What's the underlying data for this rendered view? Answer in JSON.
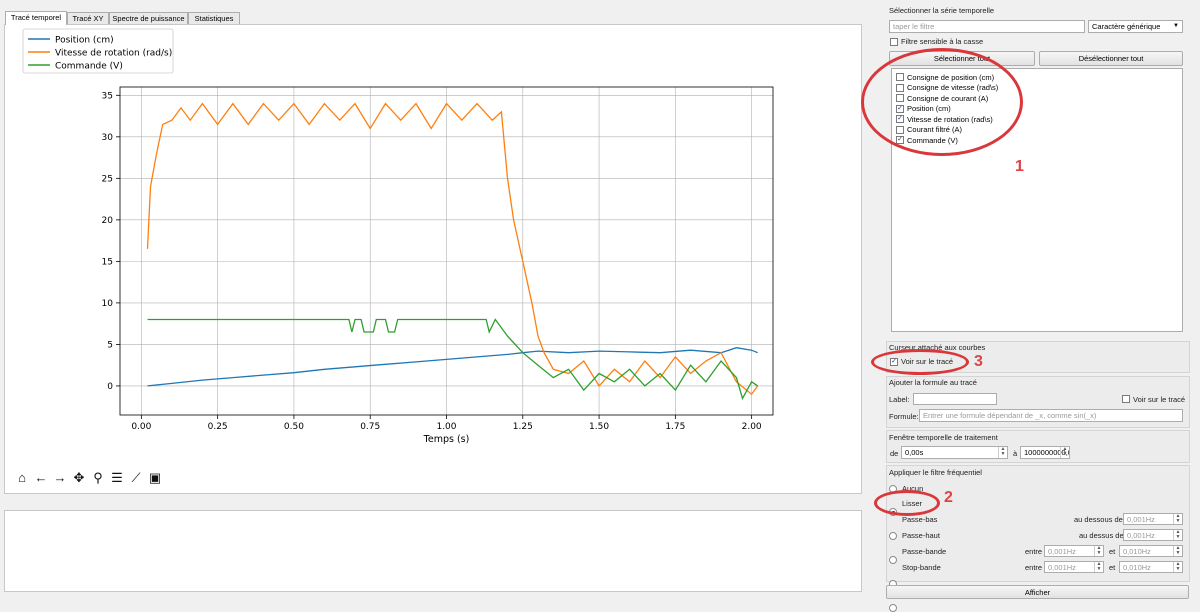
{
  "tabs": [
    "Tracé temporel",
    "Tracé XY",
    "Spectre de puissance",
    "Statistiques"
  ],
  "chart_data": {
    "type": "line",
    "xlabel": "Temps (s)",
    "ylabel": "",
    "xlim": [
      -0.07,
      2.07
    ],
    "ylim": [
      -3.5,
      36
    ],
    "xticks": [
      "0.00",
      "0.25",
      "0.50",
      "0.75",
      "1.00",
      "1.25",
      "1.50",
      "1.75",
      "2.00"
    ],
    "yticks": [
      "0",
      "5",
      "10",
      "15",
      "20",
      "25",
      "30",
      "35"
    ],
    "grid": true,
    "legend_position": "top-left",
    "series": [
      {
        "name": "Position (cm)",
        "color": "#1f77b4",
        "x": [
          0.02,
          0.1,
          0.2,
          0.3,
          0.4,
          0.5,
          0.6,
          0.7,
          0.8,
          0.9,
          1.0,
          1.1,
          1.2,
          1.25,
          1.3,
          1.4,
          1.5,
          1.6,
          1.7,
          1.8,
          1.9,
          1.95,
          2.0,
          2.02
        ],
        "y": [
          0,
          0.3,
          0.7,
          1.0,
          1.3,
          1.6,
          2.0,
          2.3,
          2.6,
          2.9,
          3.2,
          3.5,
          3.8,
          4.0,
          4.2,
          4.0,
          4.2,
          4.1,
          4.0,
          4.3,
          4.0,
          4.6,
          4.3,
          4.0
        ]
      },
      {
        "name": "Vitesse de rotation (rad/s)",
        "color": "#ff7f0e",
        "x": [
          0.02,
          0.03,
          0.05,
          0.07,
          0.1,
          0.13,
          0.16,
          0.2,
          0.25,
          0.3,
          0.35,
          0.4,
          0.45,
          0.5,
          0.55,
          0.6,
          0.65,
          0.7,
          0.75,
          0.8,
          0.85,
          0.9,
          0.95,
          1.0,
          1.05,
          1.1,
          1.15,
          1.18,
          1.2,
          1.22,
          1.25,
          1.28,
          1.3,
          1.32,
          1.35,
          1.4,
          1.45,
          1.5,
          1.55,
          1.6,
          1.65,
          1.7,
          1.75,
          1.8,
          1.85,
          1.9,
          1.95,
          2.0,
          2.02
        ],
        "y": [
          16.5,
          24,
          28,
          31.5,
          32,
          33.5,
          32,
          34,
          31.5,
          34,
          31.5,
          34,
          32,
          34,
          31.5,
          34,
          32,
          34,
          31,
          34,
          32,
          34,
          31,
          34,
          32,
          34,
          32,
          33,
          25,
          20,
          15,
          10,
          6,
          4,
          2,
          1.5,
          3,
          0,
          2,
          0.5,
          3,
          1,
          3.5,
          1.5,
          3,
          4,
          0.5,
          -1,
          0
        ]
      },
      {
        "name": "Commande (V)",
        "color": "#2ca02c",
        "x": [
          0.02,
          0.3,
          0.68,
          0.69,
          0.7,
          0.72,
          0.73,
          0.76,
          0.77,
          0.8,
          0.81,
          0.83,
          0.84,
          1.1,
          1.13,
          1.14,
          1.16,
          1.2,
          1.25,
          1.3,
          1.35,
          1.4,
          1.45,
          1.5,
          1.55,
          1.6,
          1.65,
          1.7,
          1.75,
          1.8,
          1.85,
          1.9,
          1.95,
          1.97,
          2.0,
          2.02
        ],
        "y": [
          8,
          8,
          8,
          6.5,
          8,
          8,
          6.5,
          6.5,
          8,
          8,
          6.5,
          6.5,
          8,
          8,
          8,
          6.5,
          8,
          6,
          4,
          2.5,
          1,
          2,
          -0.5,
          1.5,
          0.5,
          2,
          0,
          1.5,
          -0.5,
          2.5,
          0.5,
          3,
          1,
          -1.5,
          0.5,
          0
        ]
      }
    ]
  },
  "toolbar_icons": [
    "home-icon",
    "back-arrow-icon",
    "forward-arrow-icon",
    "pan-icon",
    "zoom-icon",
    "subplots-icon",
    "edit-curve-icon",
    "save-icon"
  ],
  "right": {
    "series_title": "Sélectionner la série temporelle",
    "filter_placeholder": "taper le filtre",
    "wildcard_select": "Caractère générique",
    "case_sensitive_label": "Filtre sensible à la casse",
    "select_all": "Sélectionner tout",
    "deselect_all": "Désélectionner tout",
    "series_items": [
      {
        "label": "Consigne de position (cm)",
        "checked": false
      },
      {
        "label": "Consigne de vitesse (rad\\s)",
        "checked": false
      },
      {
        "label": "Consigne de courant (A)",
        "checked": false
      },
      {
        "label": "Position (cm)",
        "checked": true
      },
      {
        "label": "Vitesse de rotation (rad\\s)",
        "checked": true
      },
      {
        "label": "Courant filtré (A)",
        "checked": false
      },
      {
        "label": "Commande (V)",
        "checked": true
      }
    ],
    "cursor_title": "Curseur attaché aux courbes",
    "see_on_plot": "Voir sur le tracé",
    "formula_title": "Ajouter la formule au tracé",
    "label_label": "Label:",
    "formula_label": "Formule:",
    "formula_placeholder": "Entrer une formule dépendant de _x, comme sin(_x)",
    "window_title": "Fenêtre temporelle de traitement",
    "de_label": "de",
    "from_value": "0,00s",
    "to_label": "à",
    "to_value": "1000000000,00s",
    "filter_title": "Appliquer le filtre fréquentiel",
    "filters": [
      {
        "label": "Aucun",
        "checked": false
      },
      {
        "label": "Lisser",
        "checked": true
      },
      {
        "label": "Passe-bas",
        "checked": false
      },
      {
        "label": "Passe-haut",
        "checked": false
      },
      {
        "label": "Passe-bande",
        "checked": false
      },
      {
        "label": "Stop-bande",
        "checked": false
      }
    ],
    "below_label": "au dessous de",
    "above_label": "au dessus de",
    "between_label": "entre",
    "and_label": "et",
    "lowpass_value": "0,001Hz",
    "highpass_value": "0,001Hz",
    "bandpass_low": "0,001Hz",
    "bandpass_high": "0,010Hz",
    "stopband_low": "0,001Hz",
    "stopband_high": "0,010Hz",
    "show_button": "Afficher"
  },
  "annotations": {
    "num1": "1",
    "num2": "2",
    "num3": "3"
  }
}
